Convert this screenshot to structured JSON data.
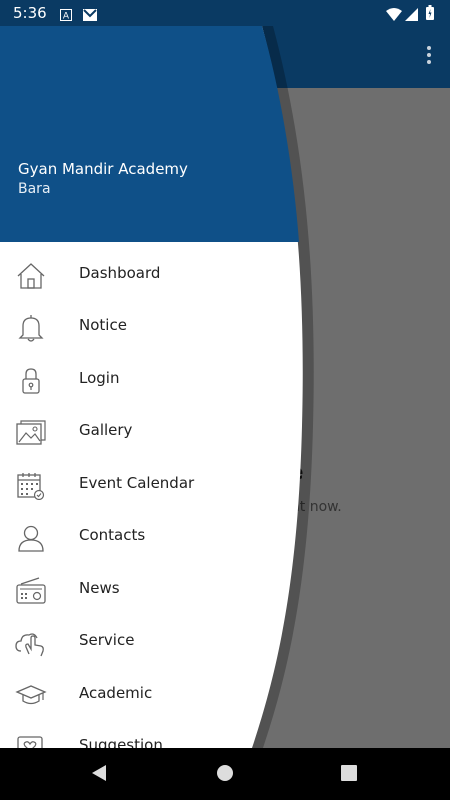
{
  "status_bar": {
    "time": "5:36",
    "icons": [
      "a-notification-icon",
      "gmail-icon",
      "wifi-icon",
      "signal-icon",
      "battery-icon"
    ]
  },
  "background": {
    "title_fragment": "le",
    "subtitle_fragment": "ght now."
  },
  "drawer": {
    "school_name": "Gyan Mandir Academy",
    "location": "Bara",
    "header_color": "#0f5088",
    "items": [
      {
        "label": "Dashboard",
        "icon": "home-icon"
      },
      {
        "label": "Notice",
        "icon": "bell-icon"
      },
      {
        "label": "Login",
        "icon": "lock-icon"
      },
      {
        "label": "Gallery",
        "icon": "gallery-icon"
      },
      {
        "label": "Event Calendar",
        "icon": "calendar-icon"
      },
      {
        "label": "Contacts",
        "icon": "person-icon"
      },
      {
        "label": "News",
        "icon": "radio-icon"
      },
      {
        "label": "Service",
        "icon": "hand-cloud-icon"
      },
      {
        "label": "Academic",
        "icon": "graduation-cap-icon"
      },
      {
        "label": "Suggestion",
        "icon": "heart-message-icon"
      }
    ]
  },
  "colors": {
    "app_bar": "#0a3a63",
    "scrim": "#6e6e6e",
    "nav_bar": "#000000"
  }
}
